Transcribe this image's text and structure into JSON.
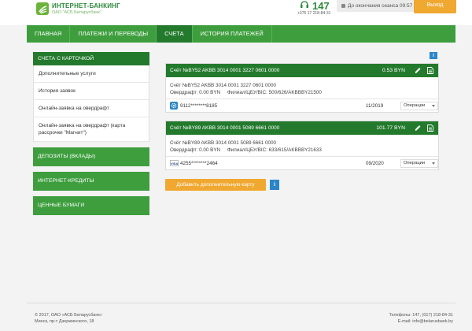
{
  "header": {
    "brand": "ИНТЕРНЕТ-БАНКИНГ",
    "brand_sub": "ОАО \"АСБ Беларусбанк\"",
    "phone_short": "147",
    "phone_full": "+375 17 218-84-31",
    "session": "До окончания сеанса 09:57",
    "exit": "Выход"
  },
  "nav": {
    "items": [
      "ГЛАВНАЯ",
      "ПЛАТЕЖИ И ПЕРЕВОДЫ",
      "СЧЕТА",
      "ИСТОРИЯ ПЛАТЕЖЕЙ"
    ],
    "active": "СЧЕТА"
  },
  "sidebar": {
    "head": "СЧЕТА С КАРТОЧКОЙ",
    "sub": [
      "Дополнительные услуги",
      "История заявок",
      "Онлайн-заявка на овердрафт",
      "Онлайн-заявка на овердрафт (карта рассрочки \"Магнит\")"
    ],
    "sections": [
      "ДЕПОЗИТЫ (ВКЛАДЫ)",
      "ИНТЕРНЕТ-КРЕДИТЫ",
      "ЦЕННЫЕ БУМАГИ"
    ]
  },
  "accounts": [
    {
      "title": "Счёт №BY52 AKBB 3014 0001 3227 0601 0000",
      "amount": "0.53 BYN",
      "line1": "Счёт №BY52 AKBB 3014 0001 3227 0601 0000",
      "line2": "Овердрафт: 0.00 BYN     Филиал/ЦБУ/BIC: 500/626/AKBBBY21500",
      "card_number": "9112********8185",
      "card_date": "11/2019",
      "card_icon": "gear-icon",
      "operations": "Операции"
    },
    {
      "title": "Счёт №BY89 AKBB 3014 0001 5089 6661 0000",
      "amount": "101.77 BYN",
      "line1": "Счёт №BY89 AKBB 3014 0001 5089 6661 0000",
      "line2": "Овердрафт: 0.00 BYN     Филиал/ЦБУ/BIC: 633/615/AKBBBY21633",
      "card_number": "4255********2464",
      "card_date": "09/2020",
      "card_icon": "visa-icon",
      "card_logo": "VISA",
      "operations": "Операции"
    }
  ],
  "actions": {
    "add_card": "Добавить дополнительную карту",
    "info": "i"
  },
  "footer": {
    "copyright": "© 2017, ОАО «АСБ Беларусбанк»",
    "address": "Минск, пр-т Дзержинского, 18",
    "phones": "Телефоны: 147, (017) 218-84-31",
    "email": "E-mail: info@belarusbank.by"
  },
  "colors": {
    "dark_green": "#237a2d",
    "green": "#3e9e3e",
    "orange": "#f0a830",
    "blue": "#2a86c9"
  }
}
